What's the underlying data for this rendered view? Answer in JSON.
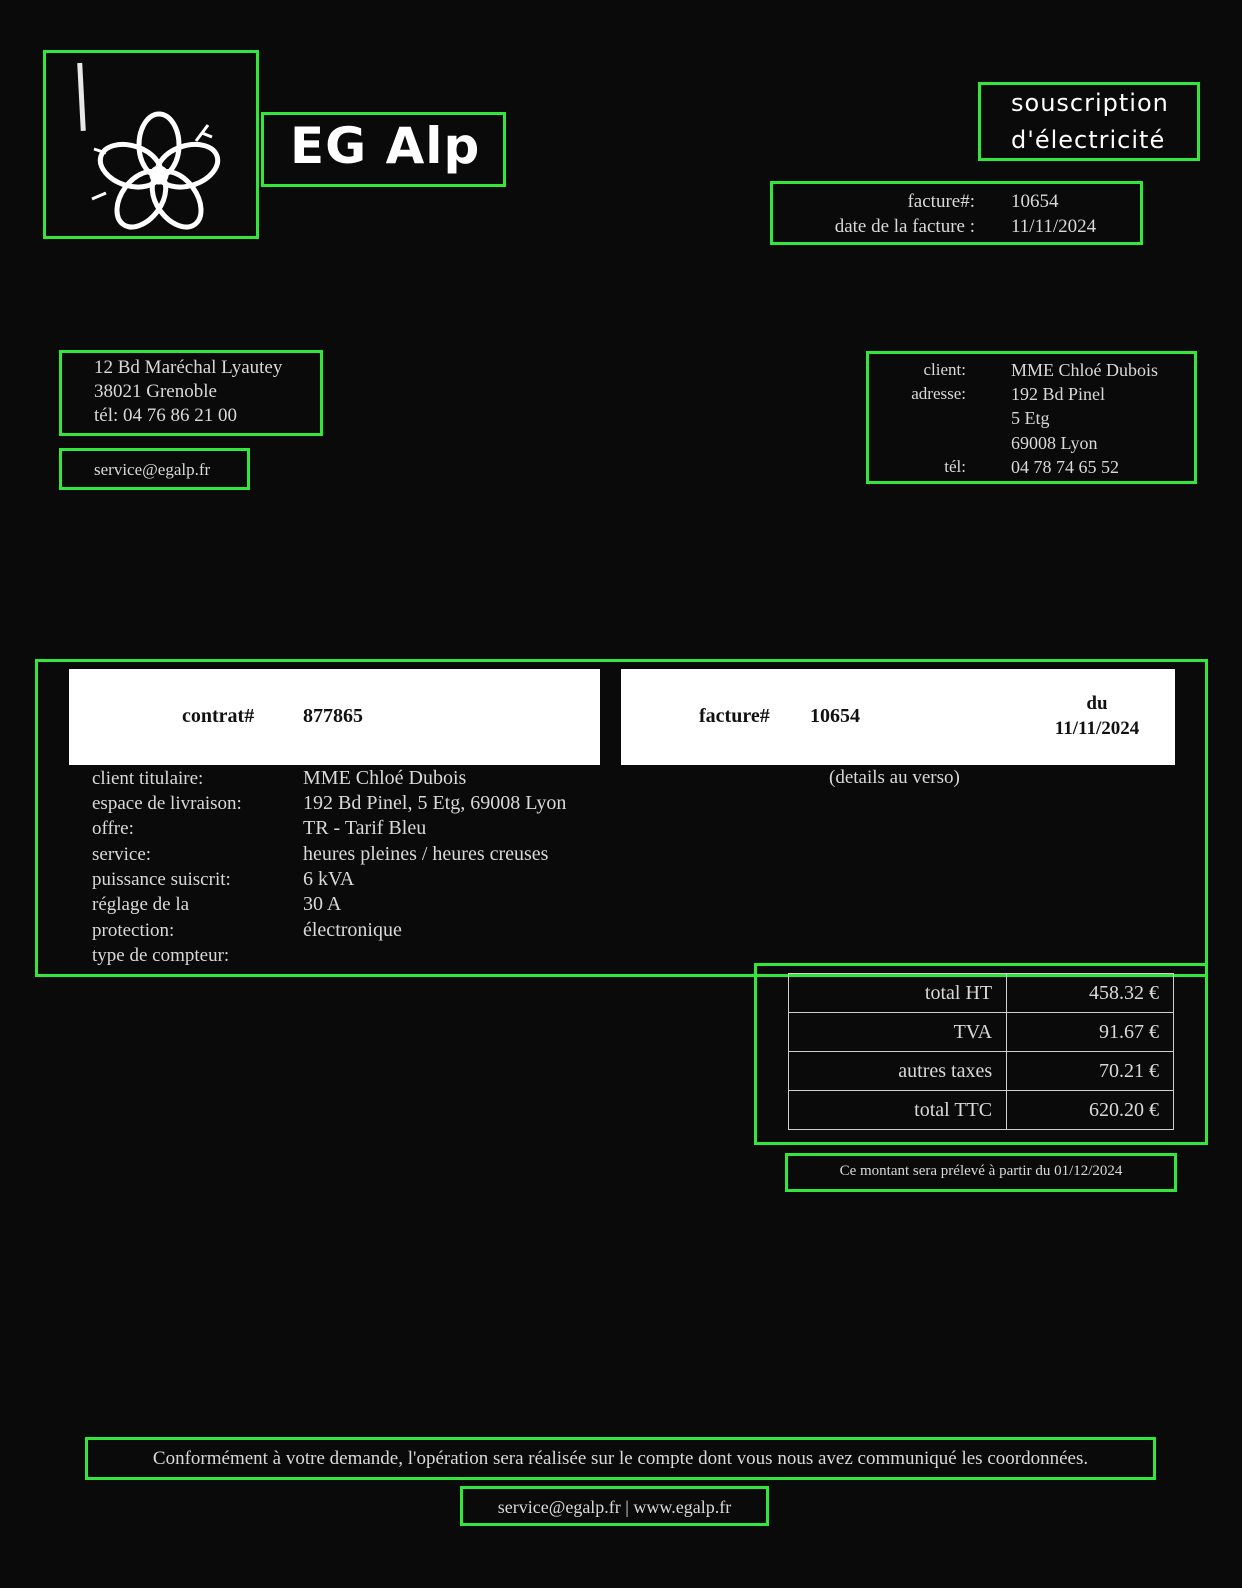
{
  "brand": {
    "name": "EG Alp",
    "logo_icon": "flower-icon"
  },
  "document": {
    "title_line1": "souscription",
    "title_line2": "d'électricité",
    "invoice_label": "facture#:",
    "invoice_number": "10654",
    "date_label": "date de la facture :",
    "date_value": "11/11/2024"
  },
  "sender": {
    "address_line1": "12 Bd Maréchal Lyautey",
    "address_line2": "38021 Grenoble",
    "phone": "tél: 04 76 86 21 00",
    "email": "service@egalp.fr"
  },
  "client": {
    "client_label": "client:",
    "client_value": "MME Chloé Dubois",
    "address_label": "adresse:",
    "address_line1": "192 Bd Pinel",
    "address_line2": "5 Etg",
    "address_line3": "69008 Lyon",
    "phone_label": "tél:",
    "phone_value": "04 78 74 65 52"
  },
  "contract": {
    "contract_label": "contrat#",
    "contract_number": "877865",
    "invoice_label": "facture#",
    "invoice_number": "10654",
    "date_prefix": "du",
    "date_value": "11/11/2024",
    "details_note": "(details au verso)",
    "details": [
      {
        "label": "client titulaire:",
        "value": "MME Chloé Dubois"
      },
      {
        "label": "espace de livraison:",
        "value": "192 Bd Pinel, 5 Etg, 69008 Lyon"
      },
      {
        "label": "offre:",
        "value": "TR - Tarif Bleu"
      },
      {
        "label": "service:",
        "value": "heures pleines / heures creuses"
      },
      {
        "label": "puissance suiscrit:",
        "value": "6 kVA"
      },
      {
        "label": "réglage de la",
        "value": "30 A"
      },
      {
        "label": "protection:",
        "value": "électronique"
      },
      {
        "label": "type de compteur:",
        "value": ""
      }
    ]
  },
  "totals": [
    {
      "label": "total HT",
      "amount": "458.32 €"
    },
    {
      "label": "TVA",
      "amount": "91.67 €"
    },
    {
      "label": "autres taxes",
      "amount": "70.21 €"
    },
    {
      "label": "total TTC",
      "amount": "620.20 €"
    }
  ],
  "payment_notice": "Ce montant sera prélevé à partir du 01/12/2024",
  "footer": {
    "note": "Conformément à votre demande, l'opération sera réalisée sur le compte dont vous nous avez communiqué les coordonnées.",
    "links": "service@egalp.fr | www.egalp.fr"
  },
  "colors": {
    "highlight_border": "#33e63a",
    "background": "#0a0a0a",
    "bar_fill": "#ffffff"
  }
}
